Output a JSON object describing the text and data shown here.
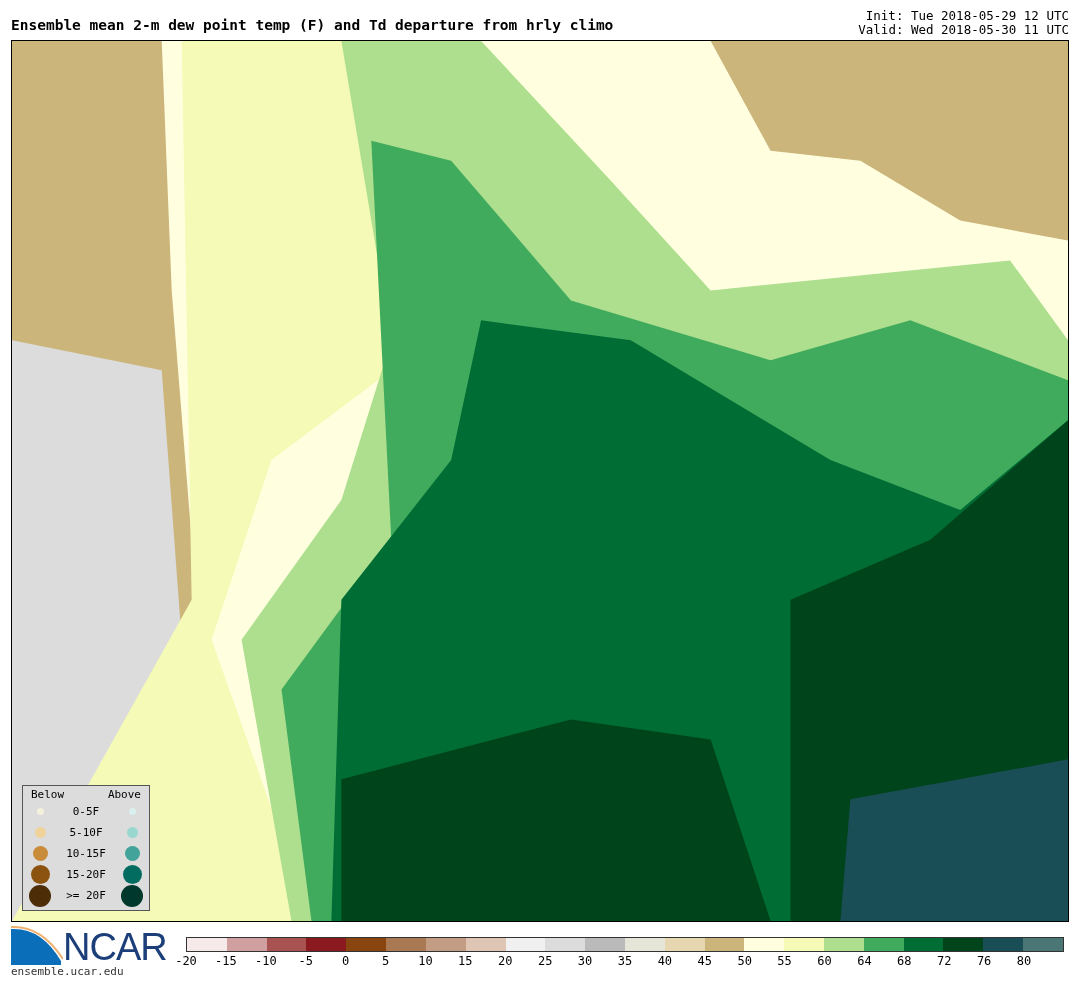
{
  "title": "Ensemble mean 2-m dew point temp (F) and Td departure from hrly climo",
  "init": "Init: Tue 2018-05-29 12 UTC",
  "valid": "Valid: Wed 2018-05-30 11 UTC",
  "legend": {
    "below_label": "Below",
    "above_label": "Above",
    "rows": [
      {
        "label": "0-5F",
        "below": {
          "color": "#f5f0dc"
        },
        "above": {
          "color": "#d8f0ee"
        }
      },
      {
        "label": "5-10F",
        "below": {
          "color": "#f0d39a"
        },
        "above": {
          "color": "#99d8cf"
        }
      },
      {
        "label": "10-15F",
        "below": {
          "color": "#c98c3a"
        },
        "above": {
          "color": "#41a399"
        }
      },
      {
        "label": "15-20F",
        "below": {
          "color": "#8c5210"
        },
        "above": {
          "color": "#016c5f"
        }
      },
      {
        "label": ">= 20F",
        "below": {
          "color": "#4d2d08"
        },
        "above": {
          "color": "#00382e"
        }
      }
    ]
  },
  "logo": {
    "name": "NCAR",
    "url": "ensemble.ucar.edu"
  },
  "colorbar": [
    {
      "label": "-20",
      "color": "#f5e9e9"
    },
    {
      "label": "-15",
      "color": "#d09fa0"
    },
    {
      "label": "-10",
      "color": "#a85252"
    },
    {
      "label": "-5",
      "color": "#8a1a1f"
    },
    {
      "label": "0",
      "color": "#88450f"
    },
    {
      "label": "5",
      "color": "#a97954"
    },
    {
      "label": "10",
      "color": "#c29c83"
    },
    {
      "label": "15",
      "color": "#dfc6b4"
    },
    {
      "label": "20",
      "color": "#f0f0f0"
    },
    {
      "label": "25",
      "color": "#dcdcdc"
    },
    {
      "label": "30",
      "color": "#bababa"
    },
    {
      "label": "35",
      "color": "#e5e5d8"
    },
    {
      "label": "40",
      "color": "#e6d7b1"
    },
    {
      "label": "45",
      "color": "#cbb57a"
    },
    {
      "label": "50",
      "color": "#ffffe0"
    },
    {
      "label": "55",
      "color": "#f5fab6"
    },
    {
      "label": "60",
      "color": "#addf8e"
    },
    {
      "label": "64",
      "color": "#41ab5d"
    },
    {
      "label": "68",
      "color": "#006d35"
    },
    {
      "label": "72",
      "color": "#00441b"
    },
    {
      "label": "76",
      "color": "#1a4e56"
    },
    {
      "label": "80",
      "color": "#4a7676"
    }
  ]
}
